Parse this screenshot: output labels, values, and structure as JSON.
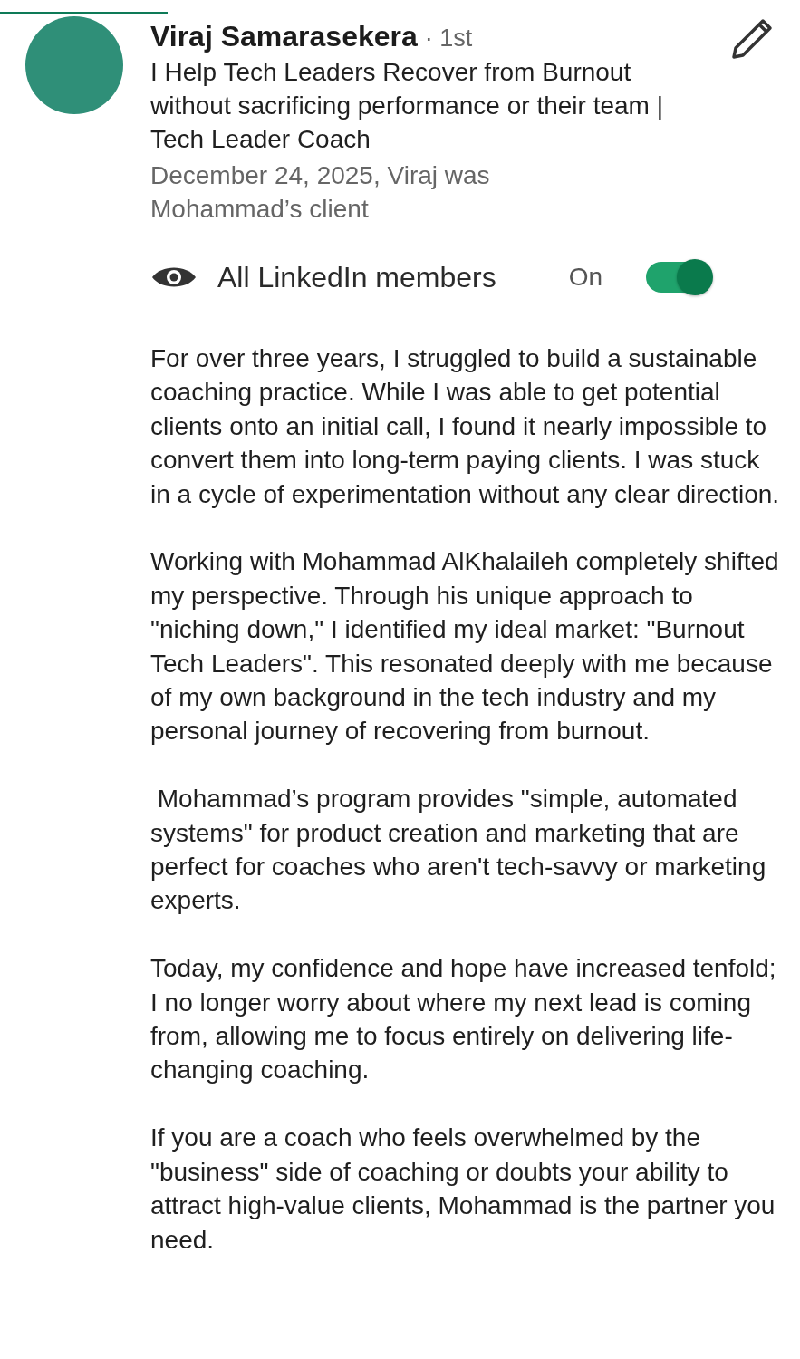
{
  "recommender": {
    "name": "Viraj Samarasekera",
    "degree": "· 1st",
    "headline": "I Help Tech Leaders Recover from Burnout without sacrificing performance or their team | Tech Leader Coach",
    "relationship": "December 24, 2025, Viraj was Mohammad’s client"
  },
  "visibility": {
    "label": "All LinkedIn members",
    "state_text": "On",
    "on": true
  },
  "paragraphs": [
    "For over three years, I struggled to build a sustainable coaching practice. While I was able to get potential clients onto an initial call, I found it nearly impossible to convert them into long-term paying clients. I was stuck in a cycle of experimentation without any clear direction.",
    "Working with Mohammad AlKhalaileh completely shifted my perspective. Through his unique approach to \"niching down,\" I identified my ideal market: \"Burnout Tech Leaders\". This resonated deeply with me because of my own background in the tech industry and my personal journey of recovering from burnout.",
    " Mohammad’s program provides \"simple, automated systems\" for product creation and marketing that are perfect for coaches who aren't tech-savvy or marketing experts.",
    "Today, my confidence and hope have increased tenfold; I no longer worry about where my next lead is coming from, allowing me to focus entirely on delivering life-changing coaching.",
    "If you are a coach who feels overwhelmed by the \"business\" side of coaching or doubts your ability to attract high-value clients, Mohammad is the partner you need."
  ]
}
